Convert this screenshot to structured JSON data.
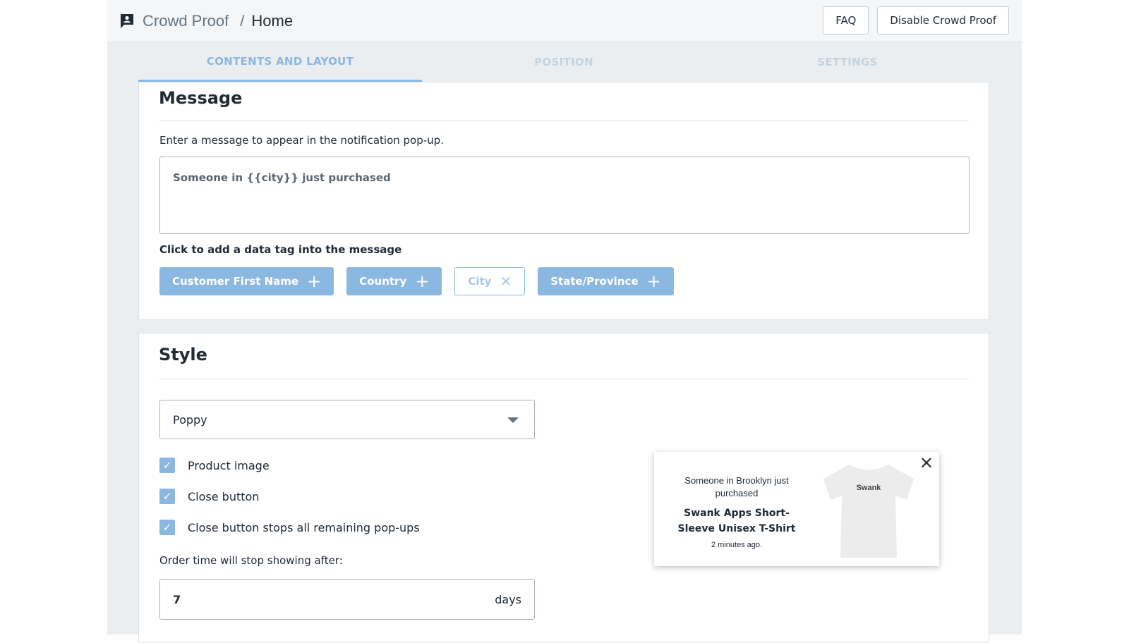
{
  "header": {
    "app_name": "Crowd Proof",
    "separator": "/",
    "page": "Home",
    "faq_label": "FAQ",
    "disable_label": "Disable Crowd Proof"
  },
  "tabs": [
    {
      "label": "CONTENTS AND LAYOUT",
      "active": true
    },
    {
      "label": "POSITION",
      "active": false
    },
    {
      "label": "SETTINGS",
      "active": false
    }
  ],
  "message": {
    "title": "Message",
    "instructions": "Enter a message to appear in the notification pop-up.",
    "value": "Someone in {{city}} just purchased",
    "tags_label": "Click to add a data tag into the message",
    "tags": [
      {
        "label": "Customer First Name",
        "icon": "plus-icon",
        "selected": false
      },
      {
        "label": "Country",
        "icon": "plus-icon",
        "selected": false
      },
      {
        "label": "City",
        "icon": "close-icon",
        "selected": true
      },
      {
        "label": "State/Province",
        "icon": "plus-icon",
        "selected": false
      }
    ]
  },
  "style": {
    "title": "Style",
    "theme": "Poppy",
    "checkboxes": [
      {
        "label": "Product image",
        "checked": true
      },
      {
        "label": "Close button",
        "checked": true
      },
      {
        "label": "Close button stops all remaining pop-ups",
        "checked": true
      }
    ],
    "order_time_label": "Order time will stop showing after:",
    "order_time_value": "7",
    "order_time_unit": "days"
  },
  "preview": {
    "message": "Someone in Brooklyn just purchased",
    "product": "Swank Apps Short-Sleeve Unisex T-Shirt",
    "time": "2 minutes ago.",
    "shirt_text": "Swank"
  },
  "colors": {
    "accent": "#8ab8e0"
  }
}
